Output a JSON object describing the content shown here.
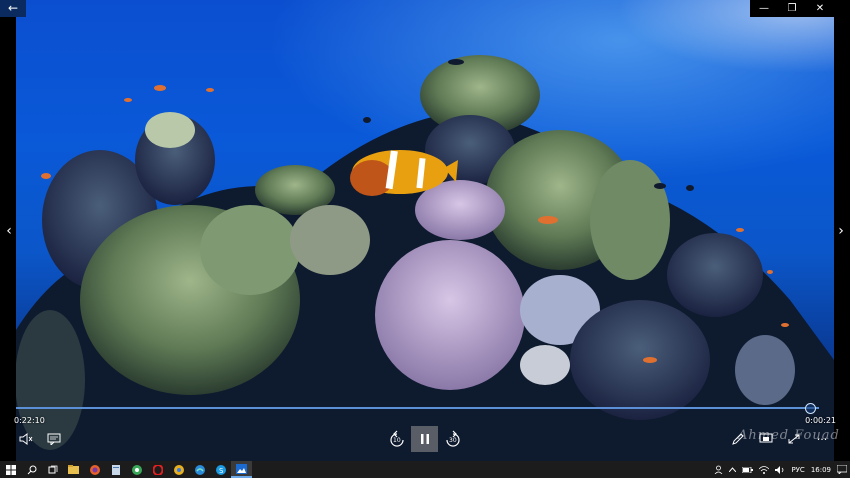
{
  "window": {
    "back_icon": "back-arrow-icon",
    "back_glyph": "←",
    "minimize_glyph": "—",
    "maximize_glyph": "❐",
    "close_glyph": "✕"
  },
  "nav": {
    "prev_glyph": "‹",
    "next_glyph": "›"
  },
  "player": {
    "elapsed": "0:22:10",
    "remaining": "0:00:21",
    "progress": 0.99,
    "skip_back_seconds": "10",
    "skip_forward_seconds": "30",
    "more_glyph": "···",
    "watermark": "Ahmed Fouad"
  },
  "taskbar": {
    "apps": [
      "windows-icon",
      "search-icon",
      "task-view-icon",
      "file-explorer-icon",
      "firefox-icon",
      "app-icon",
      "chrome-icon",
      "opera-icon",
      "chrome-icon",
      "edge-icon",
      "skype-icon",
      "photos-icon"
    ],
    "tray": {
      "language": "РУС",
      "time": "16:09"
    }
  },
  "colors": {
    "accent": "#6aa8e8",
    "taskbar": "#1c1c1c",
    "water": "#0a59d8"
  }
}
